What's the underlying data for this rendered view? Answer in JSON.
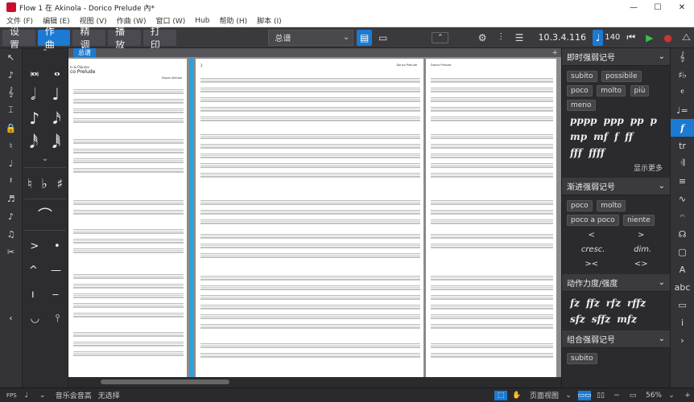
{
  "window": {
    "title": "Flow 1 在 Akinola - Dorico Prelude 內*",
    "controls": [
      "—",
      "☐",
      "✕"
    ]
  },
  "menu": [
    "文件 (F)",
    "编辑 (E)",
    "视图 (V)",
    "作曲 (W)",
    "窗口 (W)",
    "Hub",
    "帮助 (H)",
    "脚本 (I)"
  ],
  "toolbar": {
    "modes": [
      "设置",
      "作曲",
      "精调",
      "播放",
      "打印"
    ],
    "active_mode": "作曲",
    "layout_selector": "总谱",
    "timecode": "10.3.4.116",
    "tempo": "140"
  },
  "tab": {
    "label": "总谱",
    "add": "+"
  },
  "score": {
    "page_left_title": "co Prelude",
    "page_left_sub": "in & Pianino",
    "page_left_composer": "Segun Akinola",
    "page_mid_num": "2",
    "page_mid_title": "Dorico Prelude",
    "page_right_title": "Dorico Prelude"
  },
  "right_panel": {
    "sections": [
      {
        "title": "即时强弱记号",
        "chips": [
          "subito",
          "possibile",
          "poco",
          "molto",
          "più",
          "meno"
        ],
        "dynamics": [
          [
            "pppp",
            "ppp",
            "pp",
            "p"
          ],
          [
            "mp",
            "mf",
            "f",
            "ff"
          ],
          [
            "fff",
            "ffff"
          ]
        ],
        "more": "显示更多"
      },
      {
        "title": "渐进强弱记号",
        "chips": [
          "poco",
          "molto",
          "poco a poco",
          "niente"
        ],
        "hairpins": [
          [
            "<",
            ">"
          ],
          [
            "cresc.",
            "dim."
          ],
          [
            "><",
            "<>"
          ]
        ]
      },
      {
        "title": "动作力度/强度",
        "dynamics": [
          [
            "fz",
            "ffz",
            "rfz",
            "rffz"
          ],
          [
            "sfz",
            "sffz",
            "mfz"
          ]
        ]
      },
      {
        "title": "组合强弱记号",
        "chips": [
          "subito"
        ]
      }
    ]
  },
  "status": {
    "view_label": "页面视图",
    "zoom": "56%",
    "state": "音乐会音高",
    "selection": "无选择",
    "fps": "FPS"
  }
}
